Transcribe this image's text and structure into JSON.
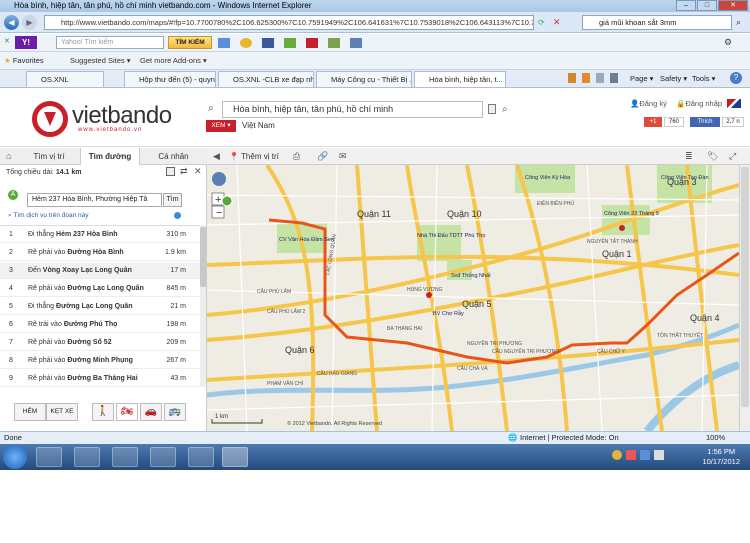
{
  "window": {
    "title": "Hòa bình, hiệp tân, tân phú, hồ chí minh vietbando.com - Windows Internet Explorer",
    "min": "–",
    "max": "□",
    "close": "✕"
  },
  "address": {
    "url": "http://www.vietbando.com/maps/#!fp=10.7700780%2C106.625300%7C10.7591949%2C106.641631%7C10.7539018%2C106.643113%7C10.7400495%2C106...",
    "search_value": "giá mũi khoan sắt 3mm"
  },
  "yahoo": {
    "placeholder": "Yahoo! Tìm kiếm",
    "search_button": "TÌM KIẾM"
  },
  "favorites": {
    "label": "Favorites",
    "items": [
      "Suggested Sites ▾",
      "Get more Add-ons ▾"
    ]
  },
  "tabs": [
    {
      "label": "OS.XNL"
    },
    {
      "label": "Hộp thư đến (5) - quyn..."
    },
    {
      "label": "OS.XNL -CLB xe đạp nh..."
    },
    {
      "label": "Máy Công cụ - Thiết Bị ..."
    },
    {
      "label": "Hòa bình, hiệp tân, t..."
    }
  ],
  "ie_commands": [
    "Page ▾",
    "Safety ▾",
    "Tools ▾"
  ],
  "vbd": {
    "logo": "vietbando",
    "logo_sub": "www.vietbando.vn",
    "query": "Hòa bình, hiệp tân, tân phú, hồ chí minh",
    "xem": "XEM ▾",
    "region": "Việt Nam",
    "register": "Đăng ký",
    "login": "Đăng nhập",
    "gplus_count": "760",
    "fb_like": "Thích",
    "fb_count": "2,7 n"
  },
  "sidebar": {
    "tabs": [
      "Tìm vị trí",
      "Tìm đường",
      "Cá nhân"
    ],
    "total_label": "Tổng chiều dài:",
    "total_value": "14.1 km",
    "start_value": "Hẻm 237 Hòa Bình, Phường Hiệp Tâ",
    "find_button": "Tìm",
    "nearby": "Tìm dịch vụ trên đoạn này",
    "steps": [
      {
        "n": "1",
        "pre": "Đi thẳng",
        "road": "Hẻm 237 Hòa Bình",
        "dist": "310 m"
      },
      {
        "n": "2",
        "pre": "Rẽ phải vào",
        "road": "Đường Hòa Bình",
        "dist": "1.9 km"
      },
      {
        "n": "3",
        "pre": "Đến",
        "road": "Vòng Xoay Lạc Long Quân",
        "dist": "17 m"
      },
      {
        "n": "4",
        "pre": "Rẽ phải vào",
        "road": "Đường Lạc Long Quân",
        "dist": "845 m"
      },
      {
        "n": "5",
        "pre": "Đi thẳng",
        "road": "Đường Lạc Long Quân",
        "dist": "21 m"
      },
      {
        "n": "6",
        "pre": "Rẽ trái vào",
        "road": "Đường Phú Thọ",
        "dist": "198 m"
      },
      {
        "n": "7",
        "pre": "Rẽ phải vào",
        "road": "Đường Số 52",
        "dist": "209 m"
      },
      {
        "n": "8",
        "pre": "Rẽ phải vào",
        "road": "Đường Minh Phụng",
        "dist": "267 m"
      },
      {
        "n": "9",
        "pre": "Rẽ phải vào",
        "road": "Đường Ba Tháng Hai",
        "dist": "43 m"
      }
    ],
    "mode_hem": "HẺM",
    "mode_ketxe": "KẸT XE"
  },
  "map": {
    "show_location": "Thêm vị trí",
    "districts": [
      "Quận 11",
      "Quận 10",
      "Quận 3",
      "Quận 1",
      "Quận 5",
      "Quận 6",
      "Quận 4"
    ],
    "places": [
      "Công Viên Kỳ Hòa",
      "Công Viên Tao Đàn",
      "Công Viên 23 Tháng 9",
      "Nhà Thi Đấu TDTT Phú Thọ",
      "CV Văn Hóa Đầm Sen",
      "BV Chợ Rẫy",
      "Svđ Thống Nhất"
    ],
    "roads": [
      "LẠC LONG QUÂN",
      "BA THÁNG HAI",
      "ĐIỆN BIÊN PHỦ",
      "NGUYỄN TRI PHƯƠNG",
      "HÙNG VƯƠNG",
      "CẦU CHÀ VÀ",
      "CẦU NGUYỄN TRI PHƯƠNG",
      "CẦU PHÚ LÂM",
      "CẦU CHỮ Y",
      "TÔN THẤT THUYẾT",
      "NGUYỄN TẤT THÀNH",
      "CẦU PHÚ LÂM 2",
      "CẦU HẬU GIANG",
      "PHẠM VĂN CHÍ"
    ],
    "scale": "1 km",
    "copyright": "© 2012 Vietbando. All Rights Reserved"
  },
  "status": {
    "left": "Done",
    "zone": "Internet | Protected Mode: On",
    "zoom": "100%"
  },
  "taskbar": {
    "time": "1:56 PM",
    "date": "10/17/2012"
  },
  "colors": {
    "brand": "#c8202a",
    "route": "#e8541a",
    "road_major": "#f5c64a"
  }
}
